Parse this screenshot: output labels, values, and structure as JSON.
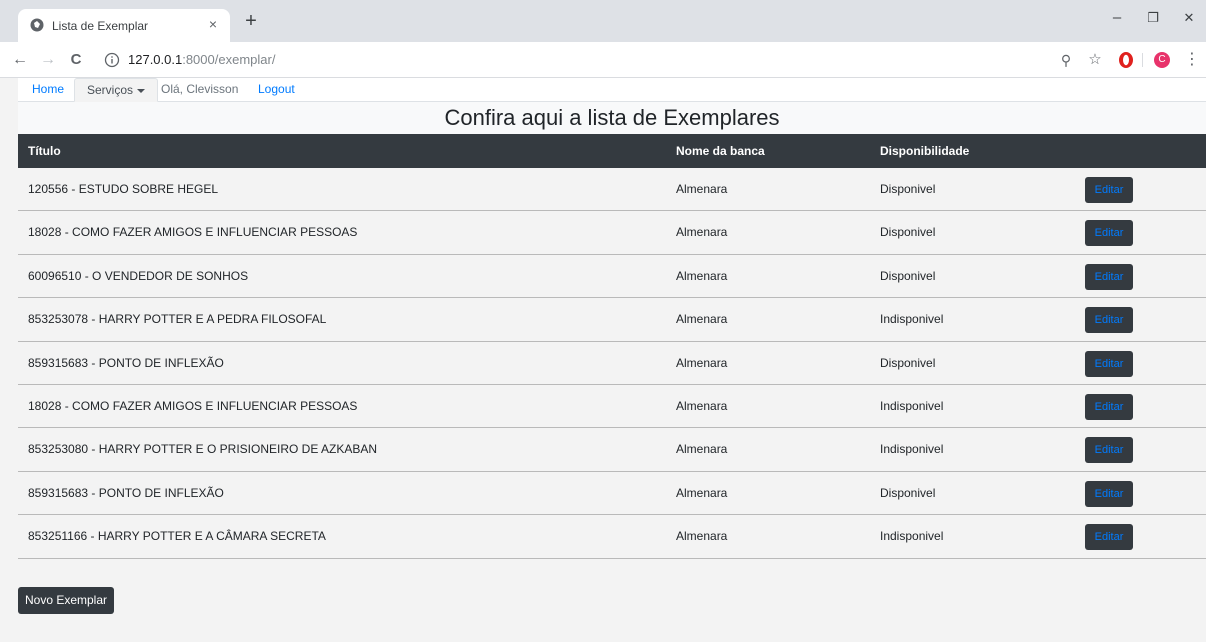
{
  "browser": {
    "tab_title": "Lista de Exemplar",
    "tab_close": "×",
    "new_tab": "+",
    "url_host": "127.0.0.1",
    "url_path": ":8000/exemplar/",
    "window_minimize": "–",
    "window_restore": "❐",
    "window_close": "✕",
    "back_icon": "←",
    "forward_icon": "→",
    "reload_icon": "C",
    "zoom_icon": "⚲",
    "star_icon": "☆",
    "menu_icon": "⋮",
    "profile_initial": "C",
    "accent_colors": {
      "opera": "#e0211e",
      "profile": "#e8336b"
    }
  },
  "navbar": {
    "home": "Home",
    "servicos": "Serviços",
    "greeting": "Olá, Clevisson",
    "logout": "Logout"
  },
  "page": {
    "heading": "Confira aqui a lista de Exemplares"
  },
  "table": {
    "headers": {
      "titulo": "Título",
      "banca": "Nome da banca",
      "disponibilidade": "Disponibilidade"
    },
    "rows": [
      {
        "titulo": "120556 - ESTUDO SOBRE HEGEL",
        "banca": "Almenara",
        "disponibilidade": "Disponivel",
        "action": "Editar"
      },
      {
        "titulo": "18028 - COMO FAZER AMIGOS E INFLUENCIAR PESSOAS",
        "banca": "Almenara",
        "disponibilidade": "Disponivel",
        "action": "Editar"
      },
      {
        "titulo": "60096510 - O VENDEDOR DE SONHOS",
        "banca": "Almenara",
        "disponibilidade": "Disponivel",
        "action": "Editar"
      },
      {
        "titulo": "853253078 - HARRY POTTER E A PEDRA FILOSOFAL",
        "banca": "Almenara",
        "disponibilidade": "Indisponivel",
        "action": "Editar"
      },
      {
        "titulo": "859315683 - PONTO DE INFLEXÃO",
        "banca": "Almenara",
        "disponibilidade": "Disponivel",
        "action": "Editar"
      },
      {
        "titulo": "18028 - COMO FAZER AMIGOS E INFLUENCIAR PESSOAS",
        "banca": "Almenara",
        "disponibilidade": "Indisponivel",
        "action": "Editar"
      },
      {
        "titulo": "853253080 - HARRY POTTER E O PRISIONEIRO DE AZKABAN",
        "banca": "Almenara",
        "disponibilidade": "Indisponivel",
        "action": "Editar"
      },
      {
        "titulo": "859315683 - PONTO DE INFLEXÃO",
        "banca": "Almenara",
        "disponibilidade": "Disponivel",
        "action": "Editar"
      },
      {
        "titulo": "853251166 - HARRY POTTER E A CÂMARA SECRETA",
        "banca": "Almenara",
        "disponibilidade": "Indisponivel",
        "action": "Editar"
      }
    ]
  },
  "actions": {
    "new_exemplar": "Novo Exemplar"
  }
}
